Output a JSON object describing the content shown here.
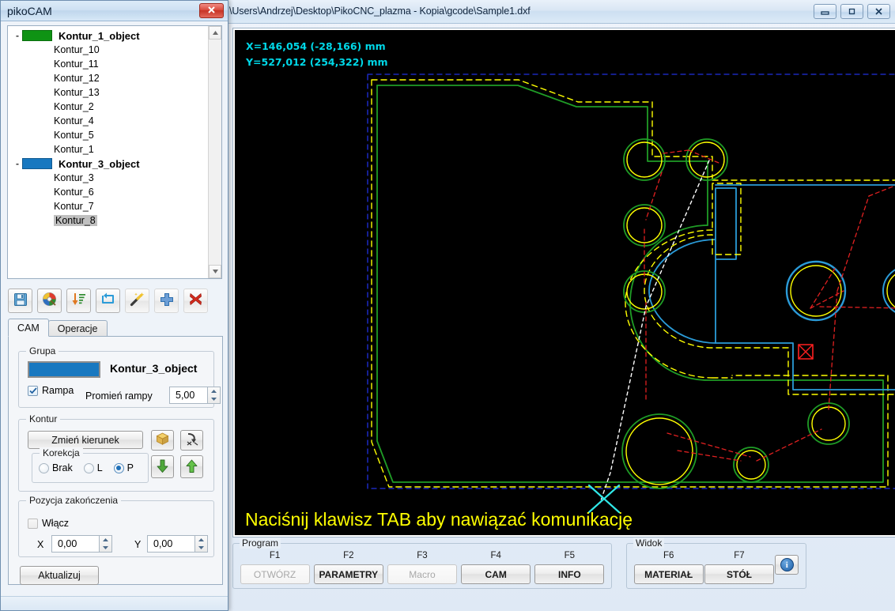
{
  "main_window": {
    "title": "\\Users\\Andrzej\\Desktop\\PikoCNC_plazma - Kopia\\gcode\\Sample1.dxf",
    "buttons": {
      "minimize": "minimize-icon",
      "maximize": "maximize-icon",
      "close": "close-icon"
    }
  },
  "viewport": {
    "coord_x": "X=146,054 (-28,166) mm",
    "coord_y": "Y=527,012 (254,322) mm",
    "message": "Naciśnij klawisz TAB aby nawiązać komunikację",
    "colors": {
      "background": "#000000",
      "coord_text": "#00d8e8",
      "message_text": "#ffff00",
      "contour_green": "#1f9c26",
      "contour_blue": "#2b9bd8",
      "toolpath_yellow": "#ffff00",
      "rapid_red": "#e02020",
      "lead_white": "#ffffff",
      "boundary_blue": "#2030e0",
      "origin_cyan": "#30e8e8",
      "marker_red": "#ff2020"
    }
  },
  "function_bar": {
    "groups": [
      {
        "label": "Program",
        "keys": [
          {
            "fkey": "F1",
            "label": "OTWÓRZ",
            "disabled": true
          },
          {
            "fkey": "F2",
            "label": "PARAMETRY",
            "disabled": false
          },
          {
            "fkey": "F3",
            "label": "Macro",
            "disabled": true
          },
          {
            "fkey": "F4",
            "label": "CAM",
            "disabled": false
          },
          {
            "fkey": "F5",
            "label": "INFO",
            "disabled": false
          }
        ]
      },
      {
        "label": "Widok",
        "keys": [
          {
            "fkey": "F6",
            "label": "MATERIAŁ",
            "disabled": false
          },
          {
            "fkey": "F7",
            "label": "STÓŁ",
            "disabled": false
          },
          {
            "fkey": "",
            "label": "i",
            "disabled": false,
            "icon": "info-icon"
          }
        ]
      }
    ]
  },
  "piko_window": {
    "title": "pikoCAM",
    "close_label": "close-icon",
    "tree": {
      "groups": [
        {
          "label": "Kontur_1_object",
          "color": "#0f9314",
          "expander": "-",
          "children": [
            "Kontur_10",
            "Kontur_11",
            "Kontur_12",
            "Kontur_13",
            "Kontur_2",
            "Kontur_4",
            "Kontur_5",
            "Kontur_1"
          ]
        },
        {
          "label": "Kontur_3_object",
          "color": "#1878c0",
          "expander": "-",
          "children": [
            "Kontur_3",
            "Kontur_6",
            "Kontur_7",
            "Kontur_8"
          ]
        }
      ],
      "selected": "Kontur_8"
    },
    "toolbar": [
      {
        "name": "save-icon",
        "title": "save"
      },
      {
        "name": "palette-icon",
        "title": "colors"
      },
      {
        "name": "sort-descending-icon",
        "title": "sort"
      },
      {
        "name": "refresh-loop-icon",
        "title": "refresh"
      },
      {
        "name": "magic-wand-icon",
        "title": "auto"
      },
      {
        "name": "plus-icon",
        "title": "add"
      },
      {
        "name": "delete-x-icon",
        "title": "delete"
      }
    ],
    "tabs": [
      {
        "label": "CAM",
        "active": true
      },
      {
        "label": "Operacje",
        "active": false
      }
    ],
    "cam": {
      "grupa": {
        "legend": "Grupa",
        "swatch_color": "#1878c0",
        "name": "Kontur_3_object",
        "rampa_label": "Rampa",
        "rampa_checked": true,
        "promien_label": "Promień rampy",
        "promien_value": "5,00"
      },
      "kontur": {
        "legend": "Kontur",
        "zmien_kierunek": "Zmień kierunek",
        "box_icon": "box-3d-icon",
        "hook_icon": "lead-in-hook-icon",
        "down_icon": "arrow-down-icon",
        "up_icon": "arrow-up-icon",
        "korekcja": {
          "legend": "Korekcja",
          "options": [
            {
              "label": "Brak",
              "selected": false
            },
            {
              "label": "L",
              "selected": false
            },
            {
              "label": "P",
              "selected": true
            }
          ]
        }
      },
      "pozycja": {
        "legend": "Pozycja zakończenia",
        "wlacz_label": "Włącz",
        "wlacz_checked": false,
        "x_label": "X",
        "x_value": "0,00",
        "y_label": "Y",
        "y_value": "0,00"
      },
      "aktualizuj_label": "Aktualizuj"
    }
  }
}
